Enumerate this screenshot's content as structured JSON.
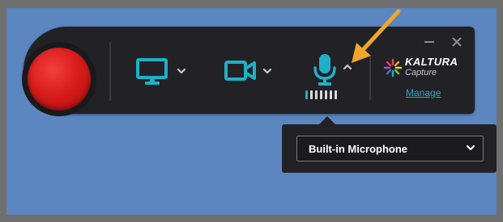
{
  "app": {
    "name": "Kaltura Capture"
  },
  "brand": {
    "name": "KALTURA",
    "subtitle": "Capture",
    "manage_link": "Manage"
  },
  "toolbar": {
    "record_button": "record",
    "screen_control": {
      "icon": "monitor-icon",
      "menu_icon": "chevron-down-icon"
    },
    "camera_control": {
      "icon": "video-camera-icon",
      "menu_icon": "chevron-down-icon"
    },
    "audio_control": {
      "icon": "microphone-icon",
      "menu_icon": "chevron-up-icon",
      "level_bars_total": 7,
      "level_bars_active": 1
    }
  },
  "window_controls": {
    "minimize": "minimize-icon",
    "close": "close-icon"
  },
  "audio_menu": {
    "selected_device": "Built-in Microphone",
    "dropdown_icon": "chevron-down-icon"
  },
  "colors": {
    "background": "#5c86c0",
    "border": "#6f6f6f",
    "toolbar": "#222226",
    "record": "#d91c1c",
    "accent": "#1fb0c7",
    "link": "#2ba6c4",
    "annotation_arrow": "#f0a62a"
  },
  "annotation": {
    "type": "arrow",
    "points_to": "microphone-menu-toggle"
  }
}
